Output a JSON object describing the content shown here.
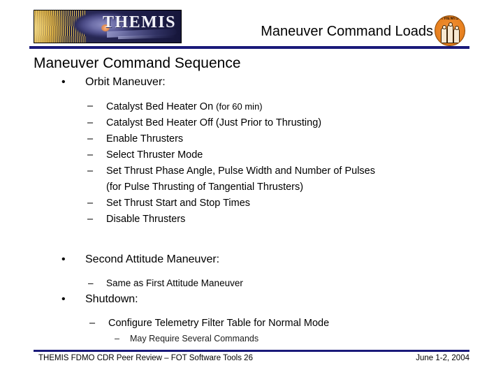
{
  "header": {
    "logo_wordmark": "THEMIS",
    "patch_text": "THEMIS",
    "title": "Maneuver Command Loads"
  },
  "slide": {
    "heading": "Maneuver Command Sequence",
    "bullet_glyph": "•",
    "dash_glyph": "–",
    "sections": [
      {
        "label": "Orbit Maneuver:",
        "items": [
          {
            "text": "Catalyst Bed Heater On ",
            "note": "(for 60 min)"
          },
          {
            "text": "Catalyst Bed Heater Off (Just Prior to Thrusting)",
            "note": ""
          },
          {
            "text": "Enable Thrusters",
            "note": ""
          },
          {
            "text": "Select Thruster Mode",
            "note": ""
          },
          {
            "text": "Set Thrust Phase Angle, Pulse Width and Number of Pulses",
            "note": ""
          },
          {
            "text": "(for Pulse Thrusting of Tangential Thrusters)",
            "note": "",
            "continuation": true
          },
          {
            "text": "Set Thrust Start and Stop Times",
            "note": ""
          },
          {
            "text": "Disable Thrusters",
            "note": ""
          }
        ]
      },
      {
        "label": "Second Attitude Maneuver:",
        "items": [
          {
            "text": "Same as First Attitude Maneuver",
            "note": ""
          }
        ]
      },
      {
        "label": "Shutdown:",
        "items": [
          {
            "text": "Configure Telemetry Filter Table for Normal Mode",
            "note": ""
          }
        ],
        "subitems": [
          {
            "text": "May Require Several Commands"
          }
        ]
      }
    ]
  },
  "footer": {
    "left": "THEMIS FDMO CDR Peer Review – FOT Software Tools 26",
    "right": "June 1-2, 2004"
  },
  "colors": {
    "rule": "#1a1a7a",
    "logo_bg": "#22224e",
    "patch": "#e8811f"
  }
}
